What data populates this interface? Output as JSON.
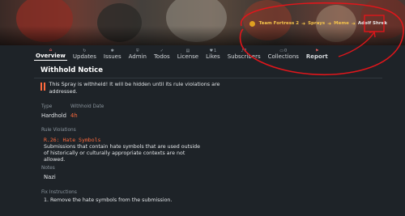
{
  "breadcrumb": {
    "game": "Team Fortress 2",
    "category": "Sprays",
    "subcategory": "Meme",
    "current": "Adolf Shrek"
  },
  "tabs": [
    {
      "label": "Overview",
      "icon": "home-icon",
      "active": true
    },
    {
      "label": "Updates",
      "icon": "refresh-icon"
    },
    {
      "label": "Issues",
      "icon": "bug-icon"
    },
    {
      "label": "Admin",
      "icon": "shield-icon"
    },
    {
      "label": "Todos",
      "icon": "check-icon"
    },
    {
      "label": "License",
      "icon": "document-icon"
    },
    {
      "label": "Likes",
      "icon": "heart-icon",
      "count": "1"
    },
    {
      "label": "Subscribers",
      "icon": "bell-icon",
      "count": "1"
    },
    {
      "label": "Collections",
      "icon": "folder-icon",
      "count": "0"
    },
    {
      "label": "Report",
      "icon": "flag-icon"
    }
  ],
  "notice": {
    "title": "Withhold Notice",
    "message": "This Spray is withheld! It will be hidden until its rule violations are addressed.",
    "type_label": "Type",
    "type_value": "Hardhold",
    "date_label": "Withhold Date",
    "date_value": "4h",
    "violations_label": "Rule Violations",
    "rule_code": "R.26: Hate Symbols",
    "rule_description": "Submissions that contain hate symbols that are used outside of historically or culturally appropriate contexts are not allowed.",
    "notes_label": "Notes",
    "notes_value": "Nazi",
    "fix_label": "Fix Instructions",
    "fix_item": "1. Remove the hate symbols from the submission."
  },
  "colors": {
    "accent": "#ff6a3d",
    "breadcrumb_highlight": "#f3c24b",
    "annotation": "#e0161b",
    "background": "#1e2328"
  }
}
